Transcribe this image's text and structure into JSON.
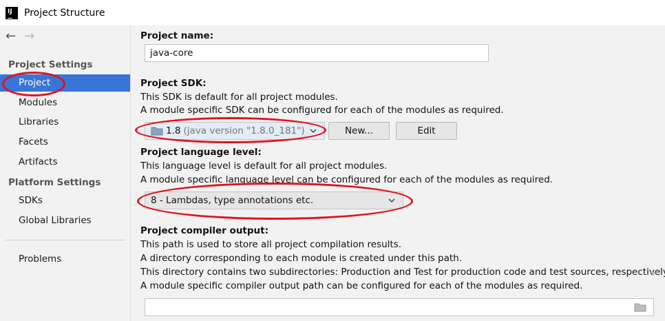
{
  "window": {
    "title": "Project Structure",
    "app_icon_label": "IJ"
  },
  "sidebar": {
    "project_settings_title": "Project Settings",
    "platform_settings_title": "Platform Settings",
    "items": [
      {
        "label": "Project",
        "selected": true
      },
      {
        "label": "Modules"
      },
      {
        "label": "Libraries"
      },
      {
        "label": "Facets"
      },
      {
        "label": "Artifacts"
      }
    ],
    "platform_items": [
      {
        "label": "SDKs"
      },
      {
        "label": "Global Libraries"
      }
    ],
    "problems_label": "Problems"
  },
  "main": {
    "project_name": {
      "label": "Project name:",
      "value": "java-core"
    },
    "project_sdk": {
      "label": "Project SDK:",
      "desc1": "This SDK is default for all project modules.",
      "desc2": "A module specific SDK can be configured for each of the modules as required.",
      "selected_sdk": "1.8",
      "selected_sdk_detail": "(java version \"1.8.0_181\")",
      "new_button": "New...",
      "edit_button": "Edit"
    },
    "language_level": {
      "label": "Project language level:",
      "desc1": "This language level is default for all project modules.",
      "desc2": "A module specific language level can be configured for each of the modules as required.",
      "selected": "8 - Lambdas, type annotations etc."
    },
    "compiler_output": {
      "label": "Project compiler output:",
      "desc1": "This path is used to store all project compilation results.",
      "desc2": "A directory corresponding to each module is created under this path.",
      "desc3": "This directory contains two subdirectories: Production and Test for production code and test sources, respectively.",
      "desc4": "A module specific compiler output path can be configured for each of the modules as required.",
      "value": ""
    }
  },
  "colors": {
    "selection": "#3875d7",
    "annotation": "#e0141e",
    "background": "#f2f2f2"
  }
}
